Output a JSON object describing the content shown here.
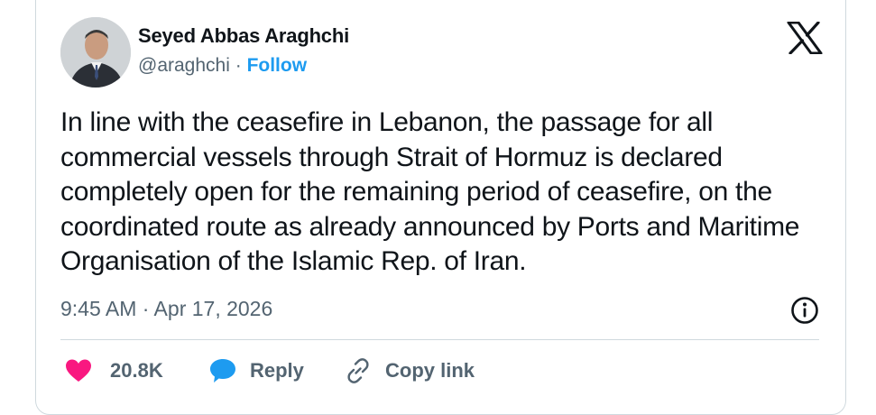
{
  "author": {
    "name": "Seyed Abbas Araghchi",
    "handle": "@araghchi",
    "separator": "·",
    "follow_label": "Follow"
  },
  "tweet": {
    "text": "In line with the ceasefire in Lebanon, the passage for all commercial vessels through Strait of Hormuz is declared completely open for the remaining period of ceasefire, on the coordinated route as already announced by Ports and Maritime Organisation of the Islamic Rep. of Iran.",
    "timestamp": "9:45 AM · Apr 17, 2026"
  },
  "actions": {
    "like_count": "20.8K",
    "reply_label": "Reply",
    "copy_link_label": "Copy link"
  },
  "icons": {
    "logo": "x-logo-icon",
    "info": "info-icon",
    "like": "heart-icon",
    "reply": "speech-bubble-icon",
    "copy": "link-icon"
  },
  "colors": {
    "text": "#0f1419",
    "secondary": "#536471",
    "accent": "#1d9bf0",
    "like": "#f91880",
    "border": "#cfd9de"
  }
}
